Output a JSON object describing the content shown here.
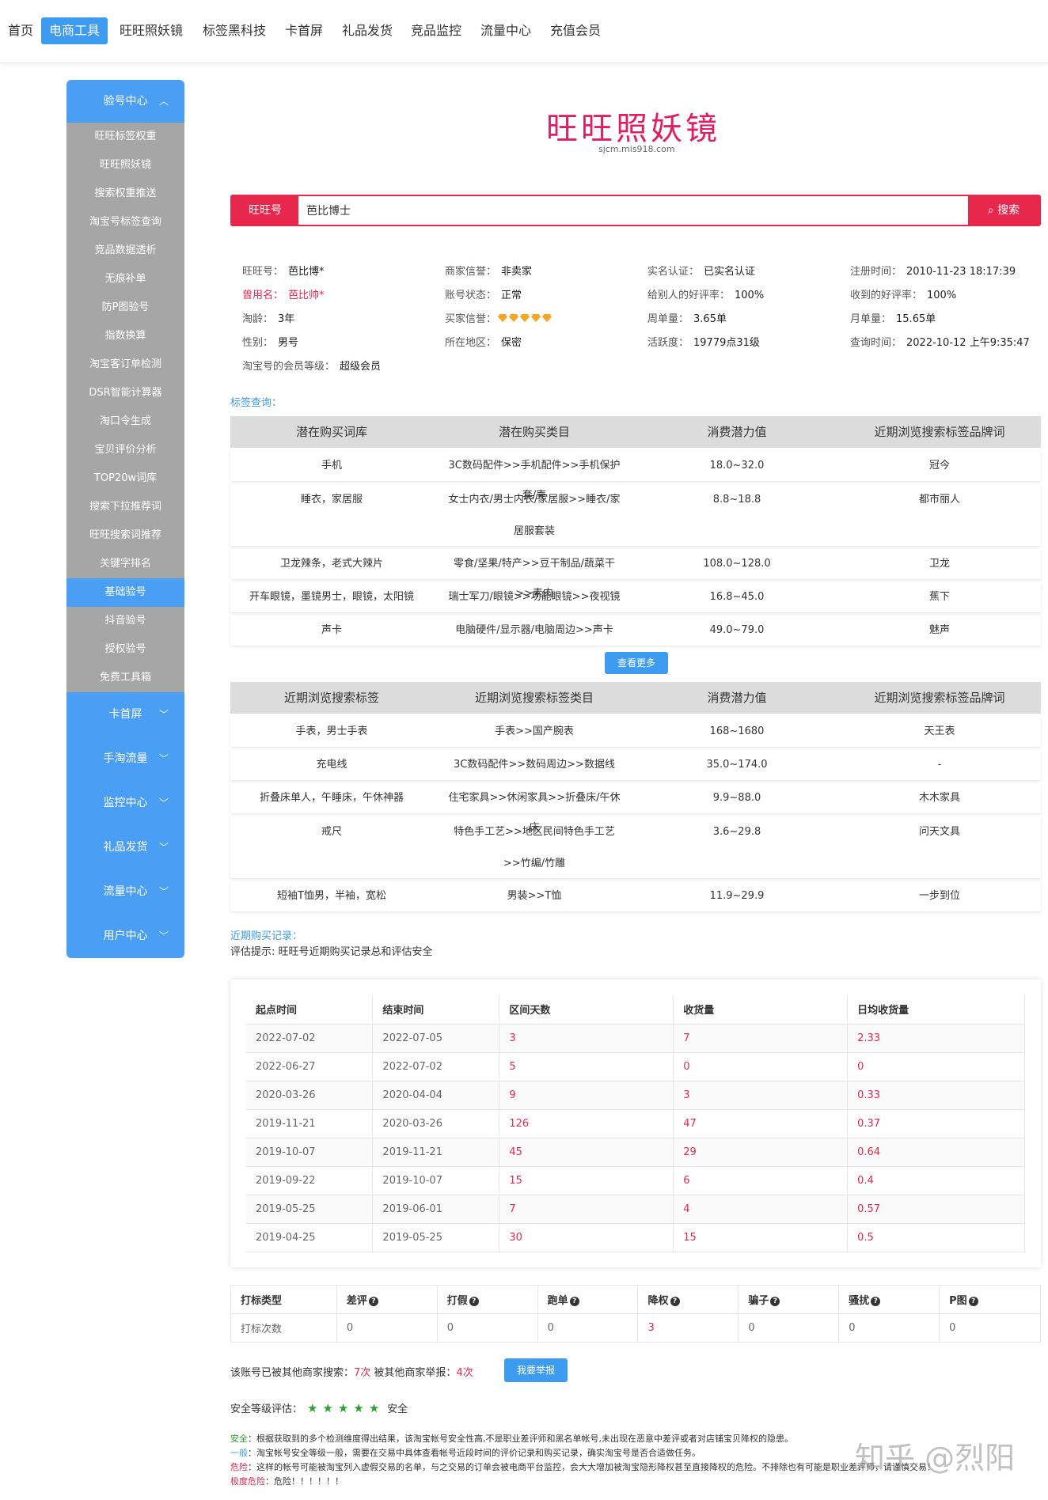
{
  "nav": {
    "items": [
      "首页",
      "电商工具",
      "旺旺照妖镜",
      "标签黑科技",
      "卡首屏",
      "礼品发货",
      "竞品监控",
      "流量中心",
      "充值会员"
    ]
  },
  "sidebar": {
    "head": "验号中心",
    "sub": [
      "旺旺标签权重",
      "旺旺照妖镜",
      "搜索权重推送",
      "淘宝号标签查询",
      "竞品数据透析",
      "无痕补单",
      "防P图验号",
      "指数换算",
      "淘宝客订单检测",
      "DSR智能计算器",
      "淘口令生成",
      "宝贝评价分析",
      "TOP20w词库",
      "搜索下拉推荐词",
      "旺旺搜索词推荐",
      "关键字排名",
      "基础验号",
      "抖音验号",
      "授权验号",
      "免费工具箱"
    ],
    "groups": [
      "卡首屏",
      "手淘流量",
      "监控中心",
      "礼品发货",
      "流量中心",
      "用户中心"
    ]
  },
  "logo": {
    "title": "旺旺照妖镜",
    "sub": "sjcm.mis918.com"
  },
  "search": {
    "label": "旺旺号",
    "value": "芭比博士",
    "button": "搜索"
  },
  "info": {
    "wangwang_l": "旺旺号：",
    "wangwang_v": "芭比博*",
    "merchant_l": "商家信誉：",
    "merchant_v": "非卖家",
    "realname_l": "实名认证：",
    "realname_v": "已实名认证",
    "reg_l": "注册时间：",
    "reg_v": "2010-11-23 18:17:39",
    "used_l": "曾用名：",
    "used_v": "芭比帅*",
    "status_l": "账号状态：",
    "status_v": "正常",
    "given_l": "给别人的好评率：",
    "given_v": "100%",
    "recv_l": "收到的好评率：",
    "recv_v": "100%",
    "age_l": "淘龄：",
    "age_v": "3年",
    "buyer_l": "买家信誉：",
    "week_l": "周单量：",
    "week_v": "3.65单",
    "month_l": "月单量：",
    "month_v": "15.65单",
    "sex_l": "性别：",
    "sex_v": "男号",
    "area_l": "所在地区：",
    "area_v": "保密",
    "active_l": "活跃度：",
    "active_v": "19779点31级",
    "query_l": "查询时间：",
    "query_v": "2022-10-12 上午9:35:47",
    "member_l": "淘宝号的会员等级：",
    "member_v": "超级会员"
  },
  "tags_label": "标签查询：",
  "table1": {
    "headers": [
      "潜在购买词库",
      "潜在购买类目",
      "消费潜力值",
      "近期浏览搜索标签品牌词"
    ],
    "rows": [
      [
        "手机",
        "3C数码配件>>手机配件>>手机保护套/壳",
        "18.0~32.0",
        "冠今"
      ],
      [
        "睡衣，家居服",
        "女士内衣/男士内衣/家居服>>睡衣/家居服套装",
        "8.8~18.8",
        "都市丽人"
      ],
      [
        "卫龙辣条，老式大辣片",
        "零食/坚果/特产>>豆干制品/蔬菜干>>素肉",
        "108.0~128.0",
        "卫龙"
      ],
      [
        "开车眼镜，墨镜男士，眼镜，太阳镜",
        "瑞士军刀/眼镜>>功能眼镜>>夜视镜",
        "16.8~45.0",
        "蕉下"
      ],
      [
        "声卡",
        "电脑硬件/显示器/电脑周边>>声卡",
        "49.0~79.0",
        "魅声"
      ]
    ]
  },
  "more_btn": "查看更多",
  "table2": {
    "headers": [
      "近期浏览搜索标签",
      "近期浏览搜索标签类目",
      "消费潜力值",
      "近期浏览搜索标签品牌词"
    ],
    "rows": [
      [
        "手表，男士手表",
        "手表>>国产腕表",
        "168~1680",
        "天王表"
      ],
      [
        "充电线",
        "3C数码配件>>数码周边>>数据线",
        "35.0~174.0",
        "-"
      ],
      [
        "折叠床单人，午睡床，午休神器",
        "住宅家具>>休闲家具>>折叠床/午休床",
        "9.9~88.0",
        "木木家具"
      ],
      [
        "戒尺",
        "特色手工艺>>地区民间特色手工艺>>竹编/竹雕",
        "3.6~29.8",
        "问天文具"
      ],
      [
        "短袖T恤男，半袖，宽松",
        "男装>>T恤",
        "11.9~29.9",
        "一步到位"
      ]
    ]
  },
  "purchase_label": "近期购买记录：",
  "hint": "评估提示: 旺旺号近期购买记录总和评估安全",
  "records": {
    "headers": [
      "起点时间",
      "结束时间",
      "区间天数",
      "收货量",
      "日均收货量"
    ],
    "rows": [
      [
        "2022-07-02",
        "2022-07-05",
        "3",
        "7",
        "2.33"
      ],
      [
        "2022-06-27",
        "2022-07-02",
        "5",
        "0",
        "0"
      ],
      [
        "2020-03-26",
        "2020-04-04",
        "9",
        "3",
        "0.33"
      ],
      [
        "2019-11-21",
        "2020-03-26",
        "126",
        "47",
        "0.37"
      ],
      [
        "2019-10-07",
        "2019-11-21",
        "45",
        "29",
        "0.64"
      ],
      [
        "2019-09-22",
        "2019-10-07",
        "15",
        "6",
        "0.4"
      ],
      [
        "2019-05-25",
        "2019-06-01",
        "7",
        "4",
        "0.57"
      ],
      [
        "2019-04-25",
        "2019-05-25",
        "30",
        "15",
        "0.5"
      ]
    ]
  },
  "marks": {
    "headers": [
      "打标类型",
      "差评",
      "打假",
      "跑单",
      "降权",
      "骗子",
      "骚扰",
      "P图"
    ],
    "row": [
      "打标次数",
      "0",
      "0",
      "0",
      "3",
      "0",
      "0",
      "0"
    ]
  },
  "searched": {
    "a": "该账号已被其他商家搜索：",
    "b": "7次",
    "c": " 被其他商家举报：",
    "d": "4次"
  },
  "report_btn": "我要举报",
  "safety": {
    "label": "安全等级评估：",
    "text": "安全"
  },
  "legend": [
    {
      "k": "安全",
      "t": "：根据获取到的多个检测维度得出结果，该淘宝帐号安全性高,不是职业差评师和黑名单帐号,未出现在恶意中差评或者对店铺宝贝降权的隐患。",
      "c": "#2ca02c"
    },
    {
      "k": "一般",
      "t": "：淘宝帐号安全等级一般，需要在交易中具体查看帐号近段时间的评价记录和购买记录，确实淘宝号是否合适做任务。",
      "c": "#3d9bf0"
    },
    {
      "k": "危险",
      "t": "：这样的帐号可能被淘宝列入虚假交易的名单，与之交易的订单会被电商平台监控，会大大增加被淘宝隐形降权甚至直接降权的危险。不排除也有可能是职业差评师，请谨慎交易！",
      "c": "#e8274d"
    },
    {
      "k": "极度危险",
      "t": "：危险！！！！！！",
      "c": "#e8274d"
    }
  ],
  "watermark": "知乎 @烈阳"
}
